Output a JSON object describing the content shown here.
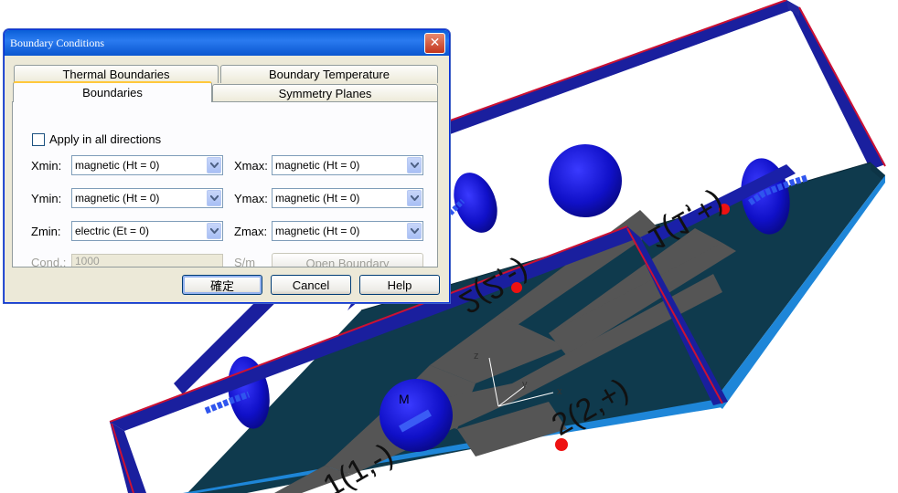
{
  "dialog": {
    "title": "Boundary Conditions",
    "close_glyph": "✕",
    "tabs": {
      "thermal": "Thermal Boundaries",
      "boundary_temperature": "Boundary Temperature",
      "boundaries": "Boundaries",
      "symmetry": "Symmetry Planes"
    },
    "apply_all_label": "Apply in all directions",
    "apply_all_checked": false,
    "fields": {
      "xmin": {
        "label": "Xmin:",
        "value": "magnetic (Ht = 0)"
      },
      "xmax": {
        "label": "Xmax:",
        "value": "magnetic (Ht = 0)"
      },
      "ymin": {
        "label": "Ymin:",
        "value": "magnetic (Ht = 0)"
      },
      "ymax": {
        "label": "Ymax:",
        "value": "magnetic (Ht = 0)"
      },
      "zmin": {
        "label": "Zmin:",
        "value": "electric (Et = 0)"
      },
      "zmax": {
        "label": "Zmax:",
        "value": "magnetic (Ht = 0)"
      }
    },
    "cond": {
      "label": "Cond.:",
      "value": "1000",
      "unit": "S/m"
    },
    "open_boundary_label": "Open Boundary",
    "buttons": {
      "ok": "確定",
      "cancel": "Cancel",
      "help": "Help"
    }
  },
  "scene": {
    "port_labels": {
      "port1": "1(1,+)",
      "port2": "2(2,+)",
      "port3": "1(1,-)",
      "port4": "2(2,-)"
    },
    "magnetic_symbol": "M",
    "axes": {
      "x": "x",
      "y": "y",
      "z": "z"
    },
    "colors": {
      "frame": "#1a1f9e",
      "frame_edge": "#cc1133",
      "substrate": "#0f3a4d",
      "substrate_edge": "#1e86d8",
      "trace": "#555555",
      "sphere": "#1515d0",
      "port_dot": "#ee1111"
    }
  }
}
